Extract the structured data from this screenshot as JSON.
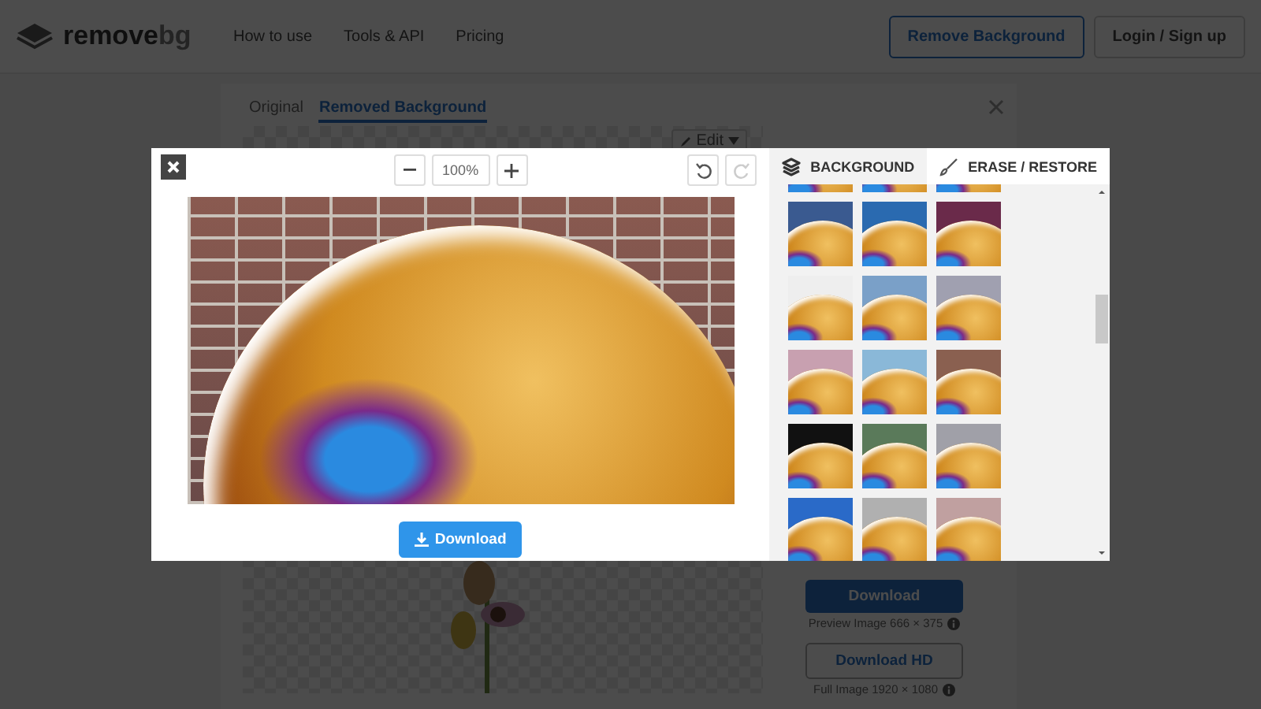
{
  "header": {
    "logo": {
      "word": "remove",
      "suffix": "bg"
    },
    "nav": [
      "How to use",
      "Tools & API",
      "Pricing"
    ],
    "buttons": [
      {
        "label": "Remove Background",
        "kind": "primary"
      },
      {
        "label": "Login / Sign up",
        "kind": "plain"
      }
    ]
  },
  "result_card": {
    "tabs": [
      {
        "label": "Original",
        "selected": false
      },
      {
        "label": "Removed Background",
        "selected": true
      }
    ],
    "edit_button": "Edit",
    "download": {
      "label": "Download",
      "note": "Preview Image 666 × 375"
    },
    "download_hd": {
      "label": "Download HD",
      "note": "Full Image 1920 × 1080"
    }
  },
  "editor": {
    "zoom": "100%",
    "download_label": "Download",
    "tabs": [
      {
        "label": "BACKGROUND",
        "kind": "layers",
        "selected": true
      },
      {
        "label": "ERASE / RESTORE",
        "kind": "brush",
        "selected": false
      }
    ]
  }
}
